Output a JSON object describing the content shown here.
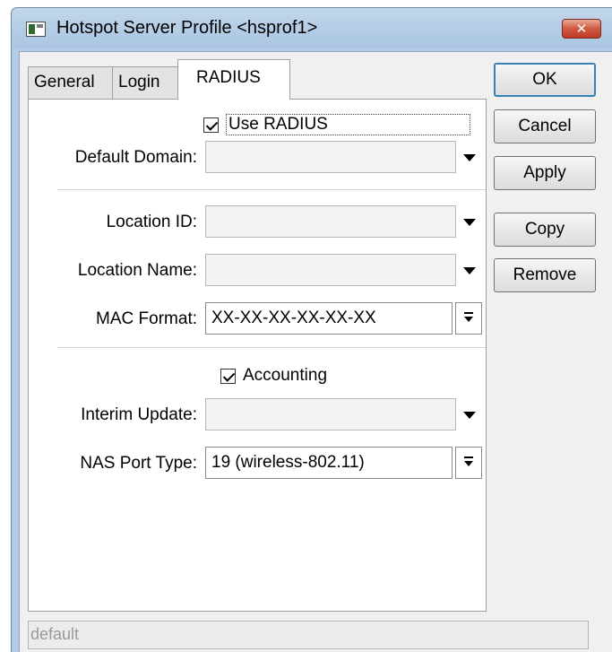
{
  "window": {
    "title": "Hotspot Server Profile <hsprof1>",
    "close_glyph": "✕"
  },
  "tabs": [
    {
      "label": "General",
      "active": false
    },
    {
      "label": "Login",
      "active": false
    },
    {
      "label": "RADIUS",
      "active": true
    }
  ],
  "radius": {
    "use_radius": {
      "label": "Use RADIUS",
      "checked": true
    },
    "default_domain": {
      "label": "Default Domain:",
      "value": ""
    },
    "location_id": {
      "label": "Location ID:",
      "value": ""
    },
    "location_name": {
      "label": "Location Name:",
      "value": ""
    },
    "mac_format": {
      "label": "MAC Format:",
      "value": "XX-XX-XX-XX-XX-XX"
    },
    "accounting": {
      "label": "Accounting",
      "checked": true
    },
    "interim_update": {
      "label": "Interim Update:",
      "value": ""
    },
    "nas_port_type": {
      "label": "NAS Port Type:",
      "value": "19 (wireless-802.11)"
    }
  },
  "buttons": {
    "ok": "OK",
    "cancel": "Cancel",
    "apply": "Apply",
    "copy": "Copy",
    "remove": "Remove"
  },
  "status": {
    "text": "default"
  },
  "colors": {
    "title_bar": "#aac6e2",
    "close_button": "#c0392b",
    "default_button_border": "#3c7fb1"
  }
}
